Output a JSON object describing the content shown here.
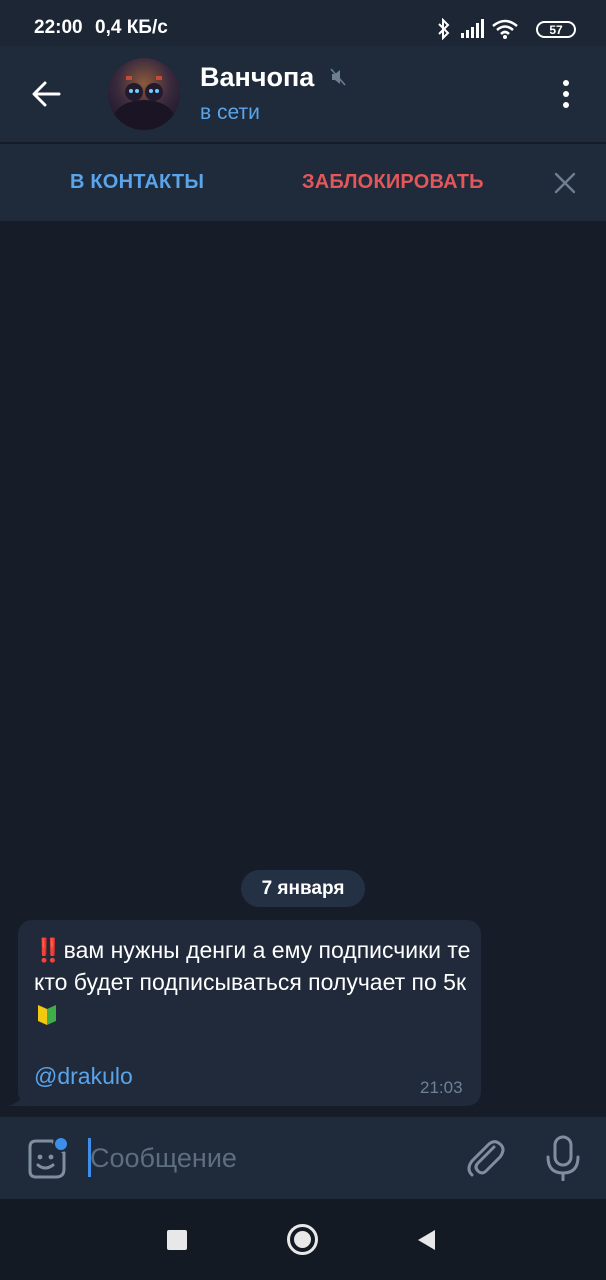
{
  "status_bar": {
    "time": "22:00",
    "speed": "0,4 КБ/с",
    "battery": "57",
    "icons": [
      "bluetooth-icon",
      "signal-icon",
      "wifi-icon",
      "battery-icon"
    ]
  },
  "header": {
    "name": "Ванчопа",
    "status": "в сети",
    "icons": [
      "back-arrow-icon",
      "mute-icon",
      "more-vert-icon"
    ]
  },
  "action_bar": {
    "add_contact": "В КОНТАКТЫ",
    "block": "ЗАБЛОКИРОВАТЬ",
    "close_icon": "close-icon"
  },
  "chat": {
    "date": "7 января",
    "message": {
      "emoji_prefix": "‼️",
      "text": "вам нужны денги а ему подписчики те кто будет подписываться получает по 5к",
      "emoji_suffix": "🔰",
      "link": "@drakulo",
      "time": "21:03"
    }
  },
  "composer": {
    "placeholder": "Сообщение",
    "icons": [
      "sticker-icon",
      "attach-icon",
      "mic-icon"
    ]
  },
  "nav_bar": {
    "icons": [
      "recents-icon",
      "home-icon",
      "back-icon"
    ]
  },
  "colors": {
    "background": "#161d28",
    "header": "#1f2a3a",
    "accent": "#5aa4ea",
    "danger": "#e3575a",
    "bubble": "#202a3a"
  }
}
